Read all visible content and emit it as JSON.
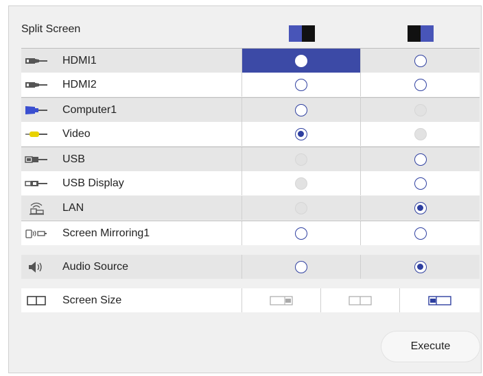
{
  "title": "Split Screen",
  "colors": {
    "accent": "#3c4aa6",
    "radio": "#2e3fa0",
    "header_blue": "#4855b8",
    "header_black": "#111111"
  },
  "header_icons": [
    "split-left-main-icon",
    "split-right-main-icon"
  ],
  "sources": [
    {
      "label": "HDMI1",
      "icon": "hdmi-plug-icon",
      "left": "selected-highlight",
      "right": "unchecked"
    },
    {
      "label": "HDMI2",
      "icon": "hdmi-plug-icon",
      "left": "unchecked",
      "right": "unchecked"
    },
    {
      "label": "Computer1",
      "icon": "vga-plug-icon",
      "left": "unchecked",
      "right": "disabled"
    },
    {
      "label": "Video",
      "icon": "rca-plug-icon",
      "left": "checked",
      "right": "disabled"
    },
    {
      "label": "USB",
      "icon": "usb-plug-icon",
      "left": "disabled",
      "right": "unchecked"
    },
    {
      "label": "USB Display",
      "icon": "usb-plug-icon",
      "left": "disabled",
      "right": "unchecked"
    },
    {
      "label": "LAN",
      "icon": "lan-network-icon",
      "left": "disabled",
      "right": "checked"
    },
    {
      "label": "Screen Mirroring1",
      "icon": "screen-mirroring-icon",
      "left": "unchecked",
      "right": "unchecked"
    }
  ],
  "audio": {
    "label": "Audio Source",
    "icon": "speaker-icon",
    "left": "unchecked",
    "right": "checked"
  },
  "screen_size": {
    "label": "Screen Size",
    "icon": "screen-size-icon",
    "options": [
      "left-larger",
      "equal",
      "right-larger"
    ],
    "selected": "right-larger"
  },
  "execute_label": "Execute"
}
